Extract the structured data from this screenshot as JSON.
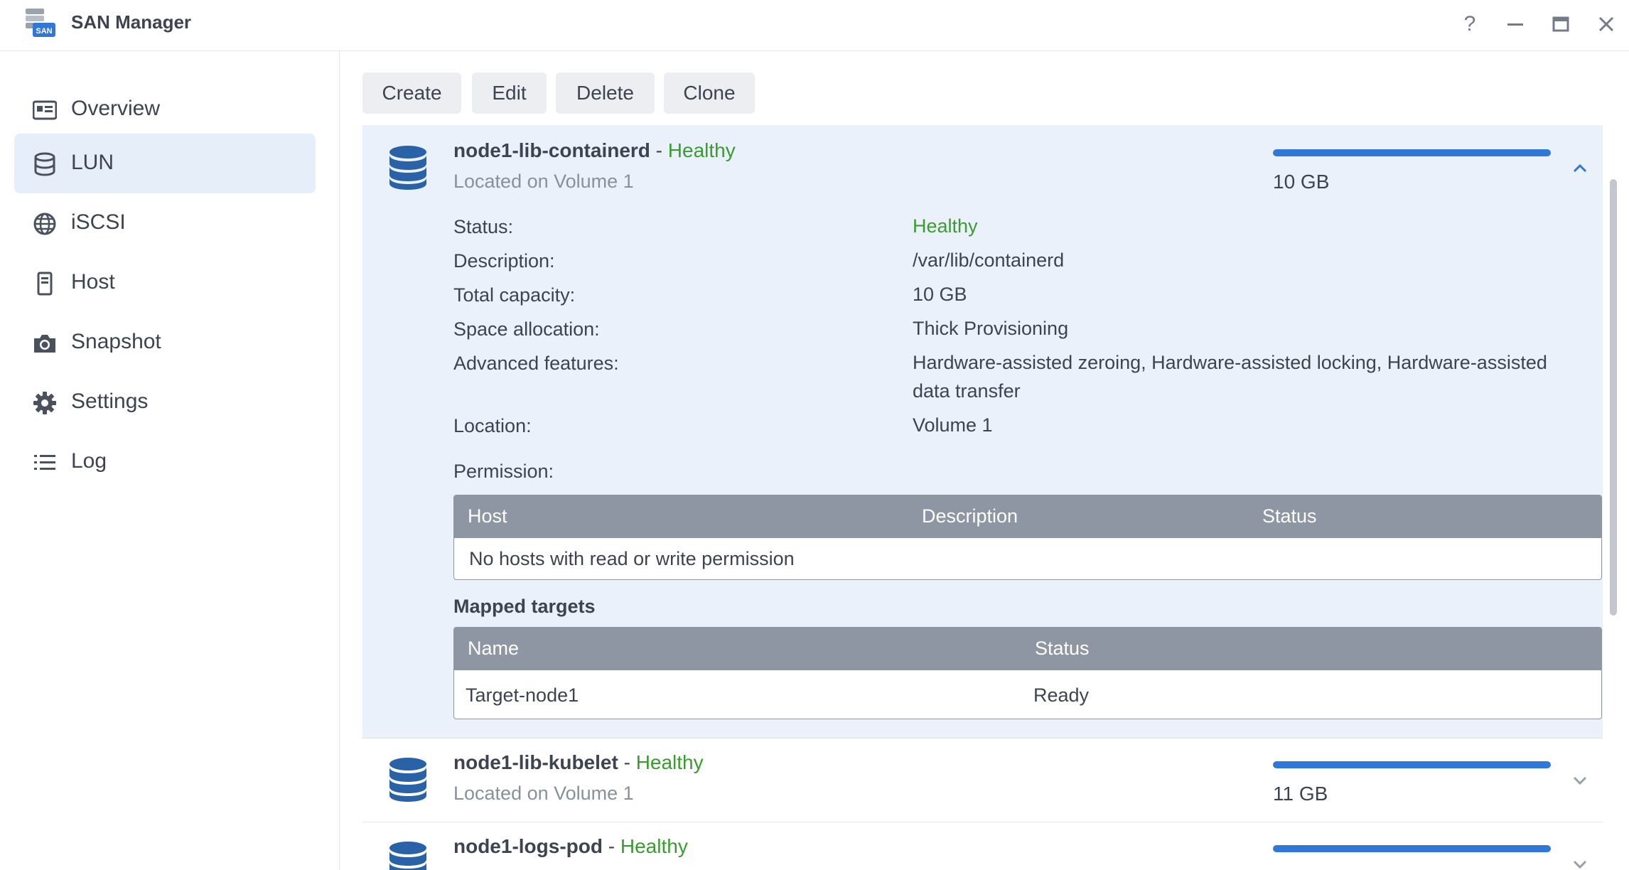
{
  "app": {
    "title": "SAN Manager",
    "icon_badge": "SAN",
    "controls": {
      "help": "?",
      "minimize": "—",
      "maximize": "▭",
      "close": "✕"
    }
  },
  "sidebar": {
    "items": [
      {
        "label": "Overview",
        "icon": "overview-icon",
        "active": false
      },
      {
        "label": "LUN",
        "icon": "database-icon",
        "active": true
      },
      {
        "label": "iSCSI",
        "icon": "globe-icon",
        "active": false
      },
      {
        "label": "Host",
        "icon": "host-icon",
        "active": false
      },
      {
        "label": "Snapshot",
        "icon": "camera-icon",
        "active": false
      },
      {
        "label": "Settings",
        "icon": "gear-icon",
        "active": false
      },
      {
        "label": "Log",
        "icon": "list-icon",
        "active": false
      }
    ]
  },
  "toolbar": {
    "create": "Create",
    "edit": "Edit",
    "delete": "Delete",
    "clone": "Clone"
  },
  "luns": [
    {
      "name": "node1-lib-containerd",
      "separator": " - ",
      "health": "Healthy",
      "location_text": "Located on Volume 1",
      "capacity": "10 GB",
      "usage_fraction": 1.0,
      "expanded": true,
      "details": {
        "status_label": "Status:",
        "status_value": "Healthy",
        "description_label": "Description:",
        "description_value": "/var/lib/containerd",
        "total_capacity_label": "Total capacity:",
        "total_capacity_value": "10 GB",
        "space_allocation_label": "Space allocation:",
        "space_allocation_value": "Thick Provisioning",
        "advanced_features_label": "Advanced features:",
        "advanced_features_value": "Hardware-assisted zeroing, Hardware-assisted locking, Hardware-assisted data transfer",
        "location_label": "Location:",
        "location_value": "Volume 1",
        "permission_label": "Permission:"
      },
      "permission_table": {
        "columns": [
          "Host",
          "Description",
          "Status"
        ],
        "empty_text": "No hosts with read or write permission"
      },
      "mapped_targets": {
        "title": "Mapped targets",
        "columns": [
          "Name",
          "Status"
        ],
        "rows": [
          {
            "name": "Target-node1",
            "status": "Ready"
          }
        ]
      }
    },
    {
      "name": "node1-lib-kubelet",
      "separator": " - ",
      "health": "Healthy",
      "location_text": "Located on Volume 1",
      "capacity": "11 GB",
      "usage_fraction": 1.0,
      "expanded": false
    },
    {
      "name": "node1-logs-pod",
      "separator": " - ",
      "health": "Healthy",
      "usage_fraction": 1.0,
      "expanded": false
    }
  ],
  "colors": {
    "accent": "#2f78d8",
    "healthy": "#3a9c2f",
    "selected_bg": "#e6eef9",
    "table_header": "#8e96a3"
  }
}
